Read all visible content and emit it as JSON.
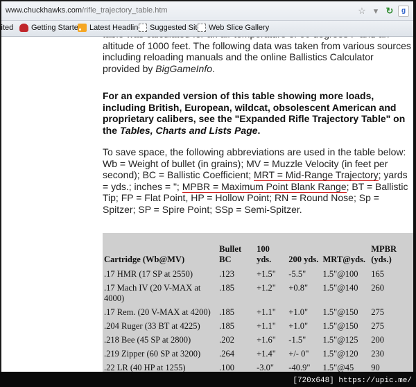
{
  "browser": {
    "url_domain": "www.chuckhawks.com",
    "url_path": "/rifle_trajectory_table.htm",
    "icons": [
      "star-icon",
      "dropdown-icon",
      "reload-icon",
      "google-icon"
    ]
  },
  "bookmarks": [
    {
      "label": "sited",
      "icon": "none"
    },
    {
      "label": "Getting Started",
      "icon": "firefox-icon"
    },
    {
      "label": "Latest Headlines",
      "icon": "rss-icon"
    },
    {
      "label": "Suggested Sites",
      "icon": "page-icon"
    },
    {
      "label": "Web Slice Gallery",
      "icon": "page-icon"
    }
  ],
  "content": {
    "p1_partial": "...table was calculated for an air temperature of 60 degrees F and an altitude of 1000 feet. The following data was taken from various sources including reloading manuals and the online Ballistics Calculator provided by",
    "p1_lead": "table was calculated for an air temperature of 60 degrees F and an altitude of 1000 feet. The following data was taken from various sources including reloading manuals and the online Ballistics Calculator provided by",
    "p1_italic": "BigGameInfo",
    "p1_end": ".",
    "p2_a": "For an expanded version of this table showing more loads, including British, European, wildcat, obsolescent American and proprietary calibers, see the \"Expanded Rifle Trajectory Table\" on the",
    "p2_italic": "Tables, Charts and Lists Page",
    "p2_end": ".",
    "p3_a": "To save space, the following abbreviations are used in the table below: Wb = Weight of bullet (in grains); MV = Muzzle Velocity (in feet per second); BC = Ballistic Coefficient;",
    "p3_mrt": "MRT = Mid-Range Trajectory",
    "p3_b": "; yards = yds.; inches = \";",
    "p3_mpbr": "MPBR = Maximum Point Blank Range",
    "p3_c": "; BT = Ballistic Tip; FP = Flat Point, HP = Hollow Point; RN = Round Nose; Sp = Spitzer; SP = Spire Point; SSp = Semi-Spitzer."
  },
  "table": {
    "headers": [
      "Cartridge (Wb@MV)",
      "Bullet BC",
      "100 yds.",
      "200 yds.",
      "MRT@yds.",
      "MPBR (yds.)"
    ],
    "rows": [
      [
        ".17 HMR (17 SP at 2550)",
        ".123",
        "+1.5\"",
        "-5.5\"",
        "1.5\"@100",
        "165"
      ],
      [
        ".17 Mach IV (20 V-MAX at 4000)",
        ".185",
        "+1.2\"",
        "+0.8\"",
        "1.5\"@140",
        "260"
      ],
      [
        ".17 Rem. (20 V-MAX at 4200)",
        ".185",
        "+1.1\"",
        "+1.0\"",
        "1.5\"@150",
        "275"
      ],
      [
        ".204 Ruger (33 BT at 4225)",
        ".185",
        "+1.1\"",
        "+1.0\"",
        "1.5\"@150",
        "275"
      ],
      [
        ".218 Bee (45 SP at 2800)",
        ".202",
        "+1.6\"",
        "-1.5\"",
        "1.5\"@125",
        "200"
      ],
      [
        ".219 Zipper (60 SP at 3200)",
        ".264",
        "+1.4\"",
        "+/- 0\"",
        "1.5\"@120",
        "230"
      ],
      [
        ".22 LR (40 HP at 1255)",
        ".100",
        "-3.0\"",
        "-40.9\"",
        "1.5\"@45",
        "90"
      ]
    ]
  },
  "footer_banner": "[720x648] https://upic.me/"
}
